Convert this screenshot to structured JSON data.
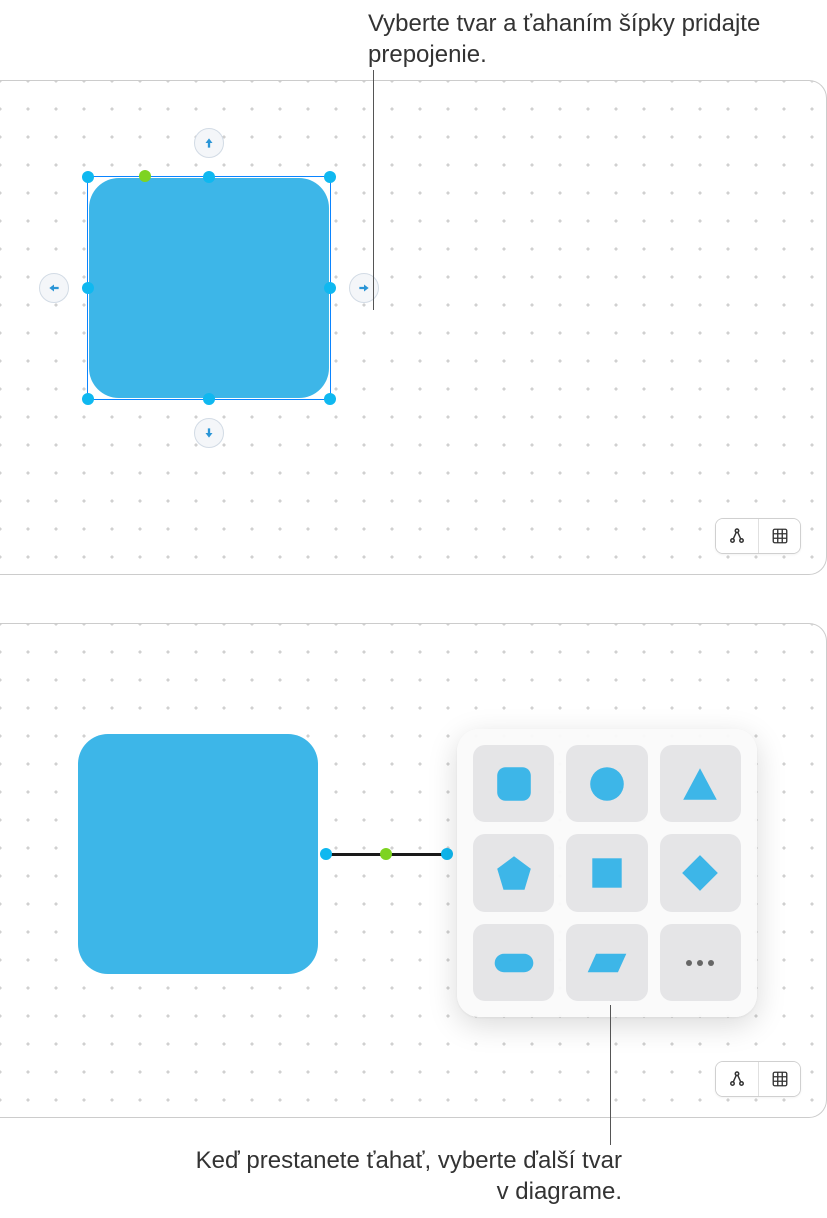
{
  "callouts": {
    "top": "Vyberte tvar a ťahaním šípky pridajte prepojenie.",
    "bottom": "Keď prestanete ťahať, vyberte ďalší tvar v diagrame."
  },
  "panel1": {
    "shape_color": "#3db6e8",
    "connection_arrows": [
      "up",
      "down",
      "left",
      "right"
    ]
  },
  "panel2": {
    "shape_color": "#3db6e8"
  },
  "shape_picker": {
    "options": [
      "rounded-square",
      "circle",
      "triangle",
      "pentagon",
      "square",
      "diamond",
      "pill",
      "parallelogram",
      "more"
    ]
  },
  "toolbar": {
    "diagram_icon": "diagram-icon",
    "grid_icon": "grid-icon"
  }
}
